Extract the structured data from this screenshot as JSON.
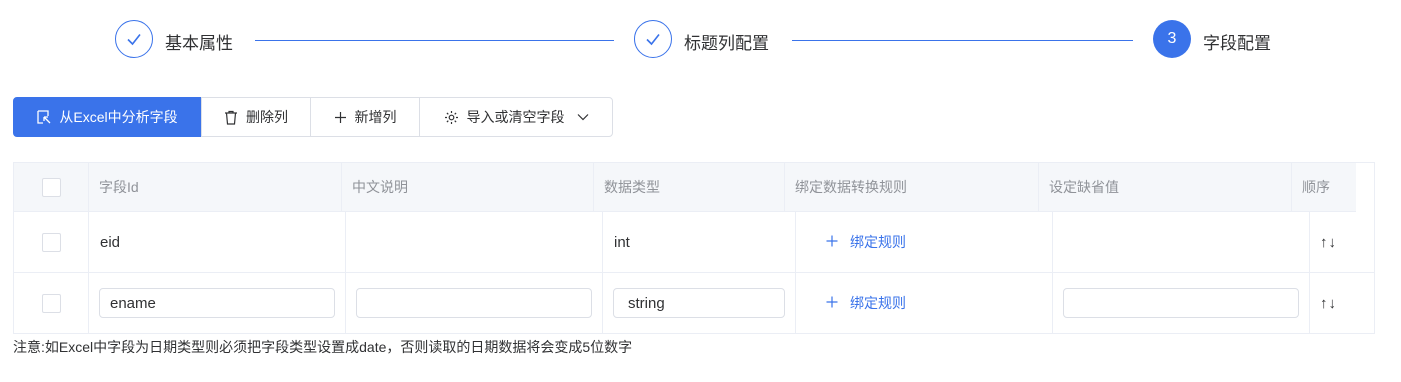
{
  "steps": [
    {
      "label": "基本属性",
      "status": "done"
    },
    {
      "label": "标题列配置",
      "status": "done"
    },
    {
      "label": "字段配置",
      "status": "active",
      "number": "3"
    }
  ],
  "toolbar": {
    "analyze_label": "从Excel中分析字段",
    "delete_label": "删除列",
    "add_label": "新增列",
    "import_label": "导入或清空字段"
  },
  "table": {
    "headers": {
      "field_id": "字段Id",
      "desc": "中文说明",
      "data_type": "数据类型",
      "bind_rule": "绑定数据转换规则",
      "default": "设定缺省值",
      "order": "顺序"
    },
    "rows": [
      {
        "field_id": "eid",
        "desc": "",
        "data_type": "int",
        "bind_label": "绑定规则",
        "default": "",
        "order": "↑↓"
      },
      {
        "field_id": "ename",
        "desc": "",
        "data_type": "string",
        "bind_label": "绑定规则",
        "default": "",
        "order": "↑↓"
      }
    ]
  },
  "note": "注意:如Excel中字段为日期类型则必须把字段类型设置成date，否则读取的日期数据将会变成5位数字",
  "colors": {
    "primary": "#3a73ea",
    "border": "#ebeef5",
    "header_bg": "#f5f7fa"
  }
}
